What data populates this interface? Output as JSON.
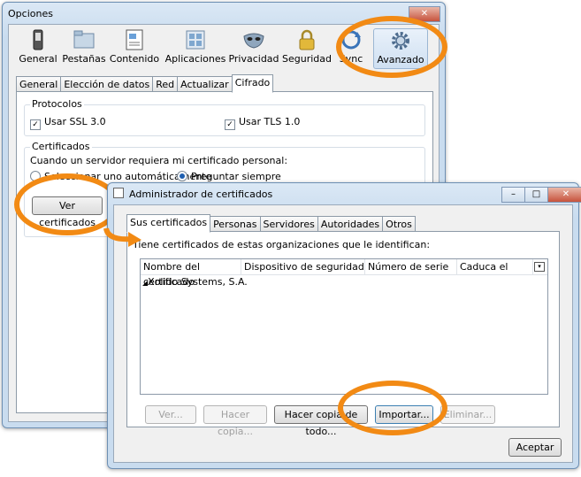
{
  "options": {
    "title": "Opciones",
    "toolbar": [
      {
        "label": "General",
        "icon": "phone-icon"
      },
      {
        "label": "Pestañas",
        "icon": "folder-tabs-icon"
      },
      {
        "label": "Contenido",
        "icon": "content-icon"
      },
      {
        "label": "Aplicaciones",
        "icon": "applications-icon"
      },
      {
        "label": "Privacidad",
        "icon": "mask-icon"
      },
      {
        "label": "Seguridad",
        "icon": "lock-icon"
      },
      {
        "label": "Sync",
        "icon": "sync-icon"
      },
      {
        "label": "Avanzado",
        "icon": "gear-icon"
      }
    ],
    "tabs": [
      "General",
      "Elección de datos",
      "Red",
      "Actualizar",
      "Cifrado"
    ],
    "active_tab": "Cifrado",
    "protocols_label": "Protocolos",
    "ssl_label": "Usar SSL 3.0",
    "tls_label": "Usar TLS 1.0",
    "certs_label": "Certificados",
    "certs_question": "Cuando un servidor requiera mi certificado personal:",
    "radio_auto": "Seleccionar uno automáticamente",
    "radio_ask": "Preguntar siempre",
    "view_certs_button": "Ver certificados"
  },
  "certmgr": {
    "title": "Administrador de certificados",
    "tabs": [
      "Sus certificados",
      "Personas",
      "Servidores",
      "Autoridades",
      "Otros"
    ],
    "active_tab": "Sus certificados",
    "description": "Tiene certificados de estas organizaciones que le identifican:",
    "columns": [
      "Nombre del certificado",
      "Dispositivo de seguridad",
      "Número de serie",
      "Caduca el"
    ],
    "rows": [
      {
        "name": "Xolido Systems, S.A."
      }
    ],
    "buttons": {
      "view": "Ver...",
      "backup": "Hacer copia...",
      "backup_all": "Hacer copia de todo...",
      "import": "Importar...",
      "delete": "Eliminar..."
    },
    "accept": "Aceptar"
  },
  "accent_color": "#f28a14"
}
